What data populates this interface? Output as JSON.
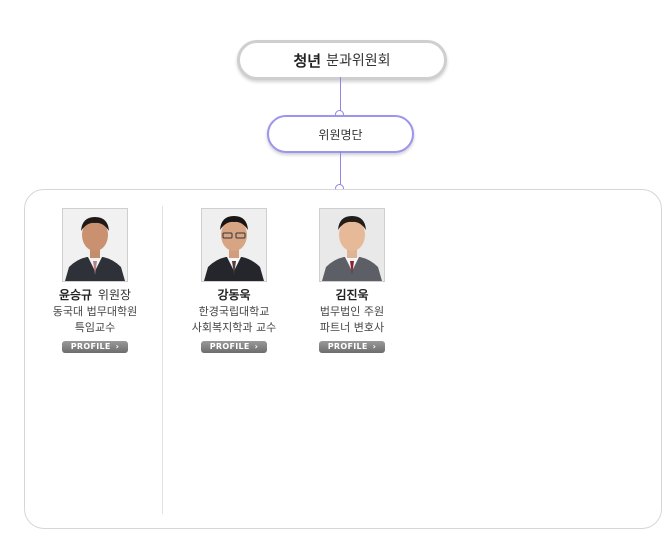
{
  "chart_top": {
    "title_bold": "청년",
    "title_rest": "분과위원회"
  },
  "sub_node": {
    "label": "위원명단"
  },
  "members": [
    {
      "name": "윤승규",
      "rank": "위원장",
      "desc_line1": "동국대 법무대학원",
      "desc_line2": "특임교수",
      "profile_label": "PROFILE",
      "profile_icon": "chevron-right-icon"
    },
    {
      "name": "강동욱",
      "rank": "",
      "desc_line1": "한경국립대학교",
      "desc_line2": "사회복지학과 교수",
      "profile_label": "PROFILE",
      "profile_icon": "chevron-right-icon"
    },
    {
      "name": "김진욱",
      "rank": "",
      "desc_line1": "법무법인 주원",
      "desc_line2": "파트너 변호사",
      "profile_label": "PROFILE",
      "profile_icon": "chevron-right-icon"
    }
  ],
  "colors": {
    "connector": "#8f86e6",
    "sub_node_border": "#9d94ee",
    "top_node_border": "#cfcfcf"
  }
}
